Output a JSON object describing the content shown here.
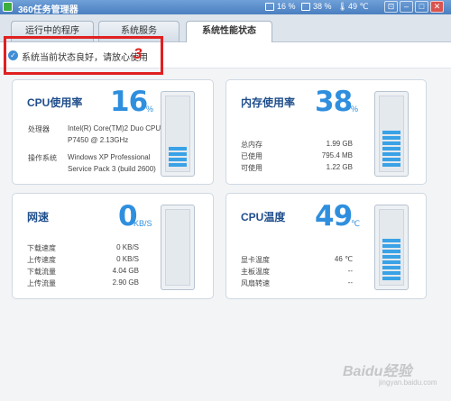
{
  "window": {
    "title": "360任务管理器",
    "cpu_stat": "16 %",
    "mem_stat": "38 %",
    "temp_stat": "49 ℃",
    "colors": {
      "accent": "#2f8fde",
      "annotation": "#e02020",
      "titlebar": "#4a7fc0"
    }
  },
  "tabs": [
    {
      "label": "运行中的程序"
    },
    {
      "label": "系统服务"
    },
    {
      "label": "系统性能状态"
    }
  ],
  "status": {
    "text": "系统当前状态良好，请放心使用"
  },
  "annotation": {
    "number": "3"
  },
  "cpu": {
    "title": "CPU使用率",
    "value": "16",
    "unit": "%",
    "level": 0.16,
    "processor_label": "处理器",
    "processor_line1": "Intel(R) Core(TM)2 Duo CPU",
    "processor_line2": "P7450 @ 2.13GHz",
    "os_label": "操作系统",
    "os_line1": "Windows XP Professional",
    "os_line2": "Service Pack 3 (build 2600)"
  },
  "memory": {
    "title": "内存使用率",
    "value": "38",
    "unit": "%",
    "level": 0.38,
    "rows": [
      {
        "label": "总内存",
        "value": "1.99 GB"
      },
      {
        "label": "已使用",
        "value": "795.4 MB"
      },
      {
        "label": "可使用",
        "value": "1.22 GB"
      }
    ]
  },
  "network": {
    "title": "网速",
    "value": "0",
    "unit": "KB/S",
    "level": 0,
    "rows": [
      {
        "label": "下载速度",
        "value": "0 KB/S"
      },
      {
        "label": "上传速度",
        "value": "0 KB/S"
      },
      {
        "label": "下载流量",
        "value": "4.04 GB"
      },
      {
        "label": "上传流量",
        "value": "2.90 GB"
      }
    ]
  },
  "temperature": {
    "title": "CPU温度",
    "value": "49",
    "unit": "℃",
    "level": 0.49,
    "rows": [
      {
        "label": "显卡温度",
        "value": "46 ℃"
      },
      {
        "label": "主板温度",
        "value": "--"
      },
      {
        "label": "风扇转速",
        "value": "--"
      }
    ]
  },
  "watermark": {
    "text": "Baidu经验",
    "sub": "jingyan.baidu.com"
  }
}
